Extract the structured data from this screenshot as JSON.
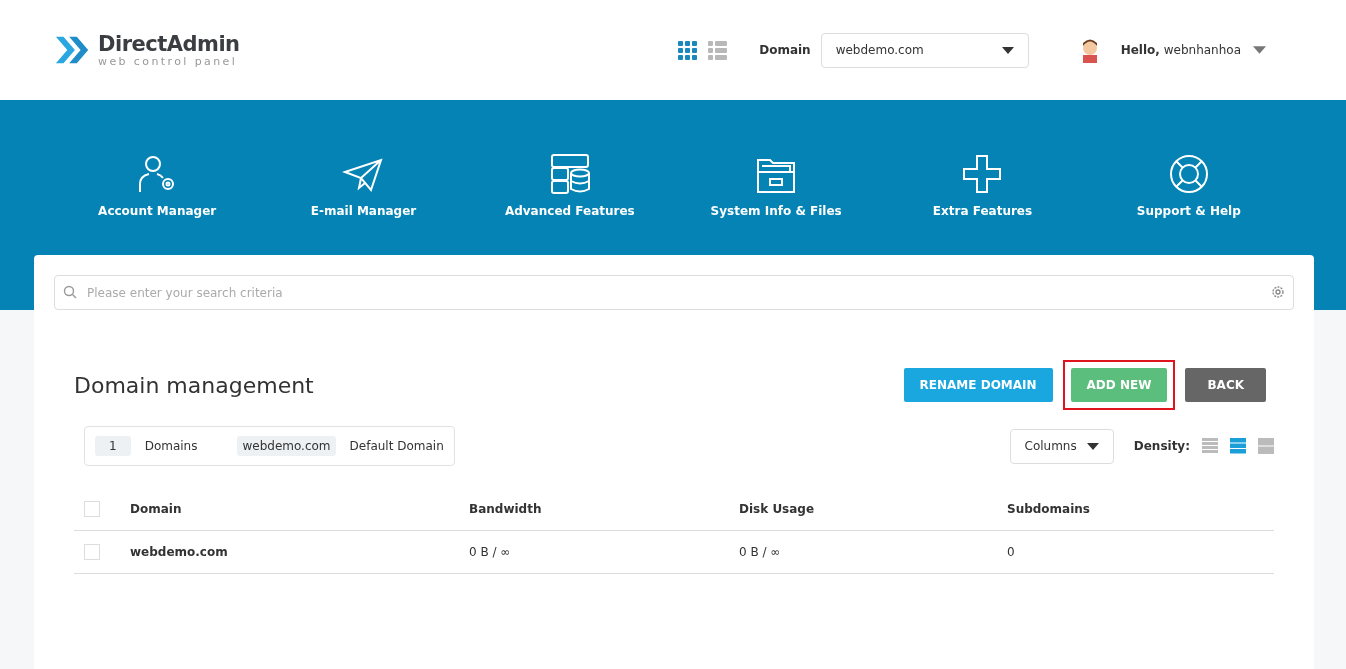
{
  "logo": {
    "name": "DirectAdmin",
    "tagline": "web control panel"
  },
  "view_switch": [
    {
      "kind": "grid",
      "selected": true
    },
    {
      "kind": "list",
      "selected": false
    }
  ],
  "domain_select": {
    "label": "Domain",
    "value": "webdemo.com"
  },
  "user": {
    "greeting": "Hello,",
    "name": "webnhanhoa"
  },
  "nav": [
    {
      "kind": "account",
      "label": "Account Manager"
    },
    {
      "kind": "email",
      "label": "E-mail Manager"
    },
    {
      "kind": "advanced",
      "label": "Advanced Features"
    },
    {
      "kind": "files",
      "label": "System Info & Files"
    },
    {
      "kind": "extra",
      "label": "Extra Features"
    },
    {
      "kind": "support",
      "label": "Support & Help"
    }
  ],
  "search": {
    "placeholder": "Please enter your search criteria"
  },
  "page_title": "Domain management",
  "buttons": [
    {
      "kind": "info",
      "label": "RENAME DOMAIN",
      "highlighted": false
    },
    {
      "kind": "success",
      "label": "ADD NEW",
      "highlighted": true
    },
    {
      "kind": "dark",
      "label": "BACK",
      "highlighted": false
    }
  ],
  "summary": {
    "count": "1",
    "count_label": "Domains",
    "default": "webdemo.com",
    "default_label": "Default Domain"
  },
  "columns_button": "Columns",
  "density": {
    "label": "Density:",
    "options": [
      {
        "kind": "compact",
        "selected": false
      },
      {
        "kind": "normal",
        "selected": true
      },
      {
        "kind": "large",
        "selected": false
      }
    ]
  },
  "table": {
    "all_checked": false,
    "columns": [
      "Domain",
      "Bandwidth",
      "Disk Usage",
      "Subdomains"
    ],
    "rows": [
      {
        "checked": false,
        "cells": [
          "webdemo.com",
          "0 B / ∞",
          "0 B / ∞",
          "0"
        ]
      }
    ]
  }
}
